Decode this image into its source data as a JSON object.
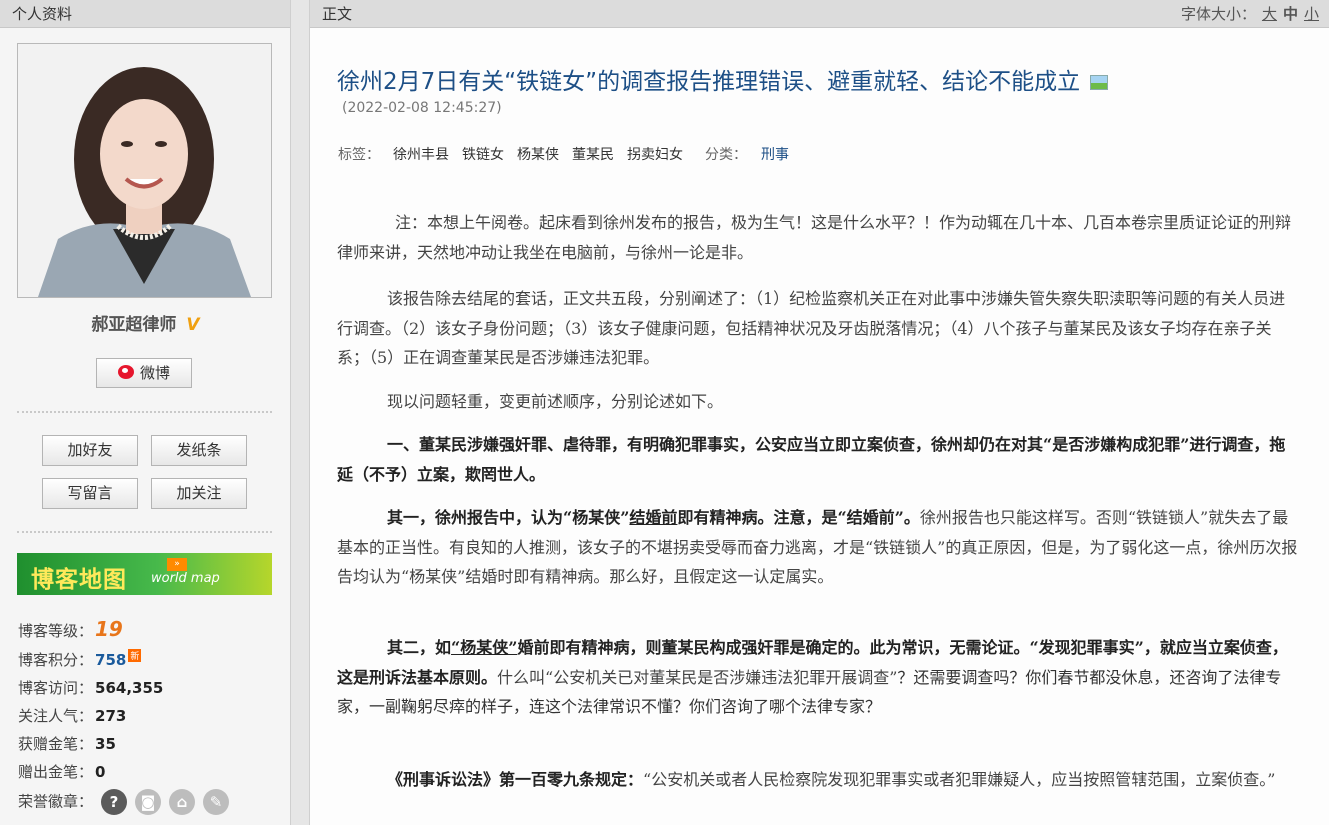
{
  "sidebar": {
    "header": "个人资料",
    "name": "郝亚超律师",
    "verify_mark": "V",
    "weibo_label": "微博",
    "buttons": {
      "add_friend": "加好友",
      "send_note": "发纸条",
      "leave_message": "写留言",
      "follow": "加关注"
    },
    "blog_map": {
      "title": "博客地图",
      "subtitle": "world map"
    },
    "stats": {
      "level_label": "博客等级：",
      "level_value": "19",
      "points_label": "博客积分：",
      "points_value": "758",
      "points_badge": "新",
      "visits_label": "博客访问：",
      "visits_value": "564,355",
      "popularity_label": "关注人气：",
      "popularity_value": "273",
      "received_pens_label": "获赠金笔：",
      "received_pens_value": "35",
      "given_pens_label": "赠出金笔：",
      "given_pens_value": "0",
      "medals_label": "荣誉徽章："
    }
  },
  "main": {
    "header": "正文",
    "font_size": {
      "label": "字体大小：",
      "large": "大",
      "medium": "中",
      "small": "小"
    },
    "title": "徐州2月7日有关“铁链女”的调查报告推理错误、避重就轻、结论不能成立",
    "time": "(2022-02-08 12:45:27)",
    "tags_label": "标签：",
    "tags": [
      "徐州丰县",
      "铁链女",
      "杨某侠",
      "董某民",
      "拐卖妇女"
    ],
    "category_label": "分类：",
    "category": "刑事",
    "p1": "注：本想上午阅卷。起床看到徐州发布的报告，极为生气！这是什么水平？！作为动辄在几十本、几百本卷宗里质证论证的刑辩律师来讲，天然地冲动让我坐在电脑前，与徐州一论是非。",
    "p2": "该报告除去结尾的套话，正文共五段，分别阐述了：（1）纪检监察机关正在对此事中涉嫌失管失察失职渎职等问题的有关人员进行调查。（2）该女子身份问题；（3）该女子健康问题，包括精神状况及牙齿脱落情况；（4）八个孩子与董某民及该女子均存在亲子关系；（5）正在调查董某民是否涉嫌违法犯罪。",
    "p3": "现以问题轻重，变更前述顺序，分别论述如下。",
    "p4": "一、董某民涉嫌强奸罪、虐待罪，有明确犯罪事实，公安应当立即立案侦查，徐州却仍在对其“是否涉嫌构成犯罪”进行调查，拖延（不予）立案，欺罔世人。",
    "p5a": "其一，徐州报告中，认为“杨某侠”",
    "p5b": "结婚前",
    "p5c": "即有精神病。注意，是“结婚前”。",
    "p5d": "徐州报告也只能这样写。否则“铁链锁人”就失去了最基本的正当性。有良知的人推测，该女子的不堪拐卖受辱而奋力逃离，才是“铁链锁人”的真正原因，但是，为了弱化这一点，徐州历次报告均认为“杨某侠”结婚时即有精神病。那么好，且假定这一认定属实。",
    "p6a": "其二，如",
    "p6b": "“杨某侠”",
    "p6c": "婚前即有精神病，则董某民构成强奸罪是确定的。此为常识，无需论证。“发现犯罪事实”，就应当立案侦查，这是刑诉法基本原则。",
    "p6d": "什么叫“公安机关已对董某民是否涉嫌违法犯罪开展调查”",
    "p6e": "？还需要调查吗？你们春节都没休息，还咨询了法律专家，一副鞠躬尽瘁的样子，连这个法律常识不懂？你们咨询了哪个法律专家？",
    "p7a": "《刑事诉讼法》第一百零九条规定：",
    "p7b": "“公安机关或者人民检察院发现犯罪事实或者犯罪嫌疑人，应当按照管辖范围，立案侦查。”"
  }
}
